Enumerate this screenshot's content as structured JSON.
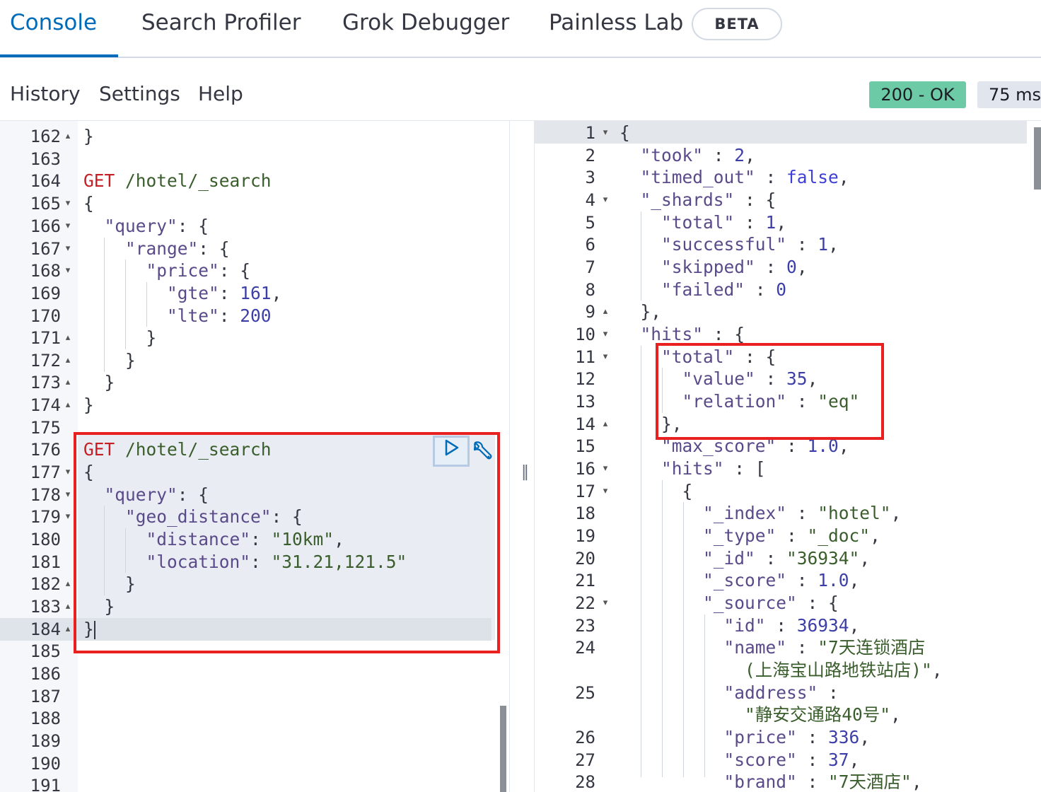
{
  "tabs": [
    {
      "label": "Console"
    },
    {
      "label": "Search Profiler"
    },
    {
      "label": "Grok Debugger"
    },
    {
      "label": "Painless Lab"
    }
  ],
  "beta_badge": "BETA",
  "toolbar": {
    "history": "History",
    "settings": "Settings",
    "help": "Help"
  },
  "response_status": {
    "status": "200 - OK",
    "time": "75 ms"
  },
  "request_editor": {
    "line_numbers": [
      "162",
      "163",
      "164",
      "165",
      "166",
      "167",
      "168",
      "169",
      "170",
      "171",
      "172",
      "173",
      "174",
      "175",
      "176",
      "177",
      "178",
      "179",
      "180",
      "181",
      "182",
      "183",
      "184",
      "185",
      "186",
      "187",
      "188",
      "189",
      "190",
      "191"
    ],
    "first_query": {
      "method": "GET",
      "path": "/hotel/_search",
      "body": {
        "query_key": "\"query\"",
        "range_key": "\"range\"",
        "price_key": "\"price\"",
        "gte_key": "\"gte\"",
        "gte_value": "161",
        "lte_key": "\"lte\"",
        "lte_value": "200"
      }
    },
    "second_query": {
      "method": "GET",
      "path": "/hotel/_search",
      "body": {
        "query_key": "\"query\"",
        "geo_key": "\"geo_distance\"",
        "distance_key": "\"distance\"",
        "distance_value": "\"10km\"",
        "location_key": "\"location\"",
        "location_value": "\"31.21,121.5\""
      }
    }
  },
  "response_viewer": {
    "line_numbers": [
      "1",
      "2",
      "3",
      "4",
      "5",
      "6",
      "7",
      "8",
      "9",
      "10",
      "11",
      "12",
      "13",
      "14",
      "15",
      "16",
      "17",
      "18",
      "19",
      "20",
      "21",
      "22",
      "23",
      "24",
      "25",
      "26",
      "27",
      "28"
    ],
    "took": {
      "key": "\"took\"",
      "value": "2"
    },
    "timed_out": {
      "key": "\"timed_out\"",
      "value": "false"
    },
    "shards": {
      "key": "\"_shards\"",
      "total_key": "\"total\"",
      "total": "1",
      "successful_key": "\"successful\"",
      "successful": "1",
      "skipped_key": "\"skipped\"",
      "skipped": "0",
      "failed_key": "\"failed\"",
      "failed": "0"
    },
    "hits": {
      "key": "\"hits\"",
      "total_key": "\"total\"",
      "value_key": "\"value\"",
      "value": "35",
      "relation_key": "\"relation\"",
      "relation": "\"eq\"",
      "max_score_key": "\"max_score\"",
      "max_score": "1.0",
      "hits_key": "\"hits\""
    },
    "doc": {
      "index_key": "\"_index\"",
      "index": "\"hotel\"",
      "type_key": "\"_type\"",
      "type": "\"_doc\"",
      "id_key": "\"_id\"",
      "id": "\"36934\"",
      "score_key": "\"_score\"",
      "score": "1.0",
      "source_key": "\"_source\"",
      "src_id_key": "\"id\"",
      "src_id": "36934",
      "name_key": "\"name\"",
      "name_line1": "\"7天连锁酒店",
      "name_line2": "(上海宝山路地铁站店)\"",
      "address_key": "\"address\"",
      "address": "\"静安交通路40号\"",
      "price_key": "\"price\"",
      "price": "336",
      "score2_key": "\"score\"",
      "score2": "37",
      "brand_key": "\"brand\"",
      "brand": "\"7天酒店\""
    }
  }
}
